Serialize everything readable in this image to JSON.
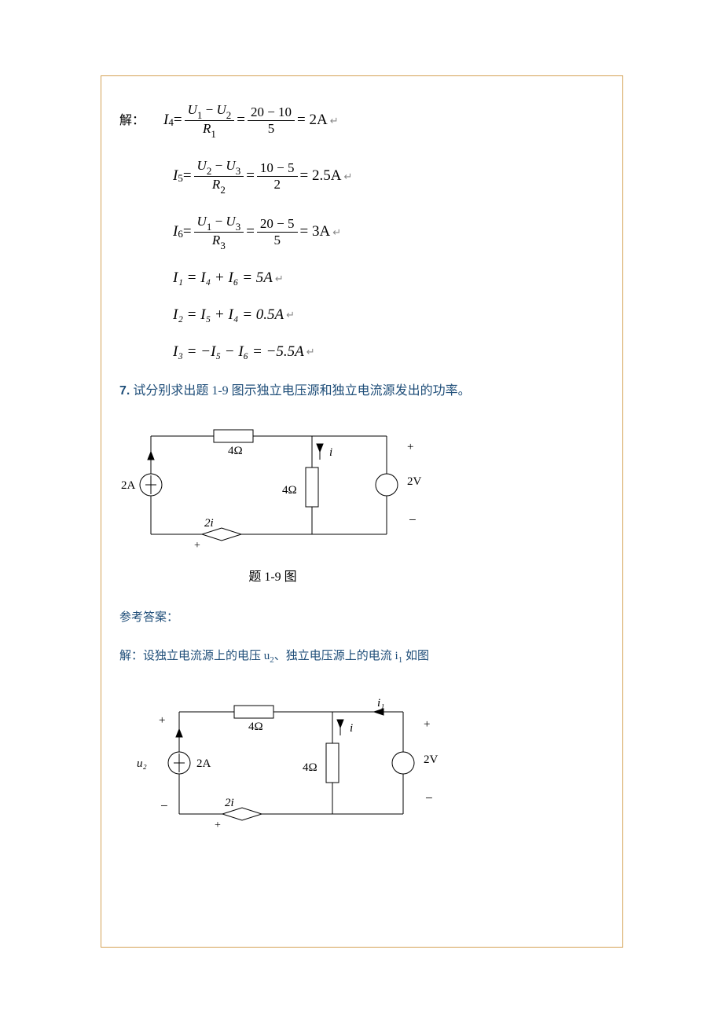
{
  "eq": {
    "label": "解：",
    "i4": {
      "lhs": "I",
      "sub": "4",
      "num1a": "U",
      "num1as": "1",
      "minus": " − ",
      "num1b": "U",
      "num1bs": "2",
      "den1": "R",
      "den1s": "1",
      "num2": "20 − 10",
      "den2": "5",
      "res": "= 2A"
    },
    "i5": {
      "lhs": "I",
      "sub": "5",
      "num1a": "U",
      "num1as": "2",
      "minus": " − ",
      "num1b": "U",
      "num1bs": "3",
      "den1": "R",
      "den1s": "2",
      "num2": "10 − 5",
      "den2": "2",
      "res": "= 2.5A"
    },
    "i6": {
      "lhs": "I",
      "sub": "6",
      "num1a": "U",
      "num1as": "1",
      "minus": " − ",
      "num1b": "U",
      "num1bs": "3",
      "den1": "R",
      "den1s": "3",
      "num2": "20 − 5",
      "den2": "5",
      "res": "= 3A"
    },
    "i1": "I₁ = I₄ + I₆ = 5A",
    "i2": "I₂ = I₅ + I₄ = 0.5A",
    "i3": "I₃ = −I₅ − I₆ = −5.5A"
  },
  "q7": {
    "num": "7.",
    "text": "  试分别求出题 1-9 图示独立电压源和独立电流源发出的功率。"
  },
  "fig1": {
    "r_top": "4Ω",
    "r_mid": "4Ω",
    "i_src": "2A",
    "v_src": "2V",
    "i_label": "i",
    "dep_src": "2i",
    "plus": "+",
    "minus": "−",
    "caption": "题 1-9 图"
  },
  "ans": {
    "label": "参考答案：",
    "text_a": "解：设独立电流源上的电压 u",
    "text_b": "、独立电压源上的电流 i",
    "text_c": " 如图",
    "sub_u": "2",
    "sub_i": "1"
  },
  "fig2": {
    "r_top": "4Ω",
    "r_mid": "4Ω",
    "i_src": "2A",
    "v_src": "2V",
    "i_label": "i",
    "i1_label": "i₁",
    "u2_label": "u₂",
    "dep_src": "2i",
    "plus": "+",
    "minus": "−"
  },
  "ret": "↵"
}
